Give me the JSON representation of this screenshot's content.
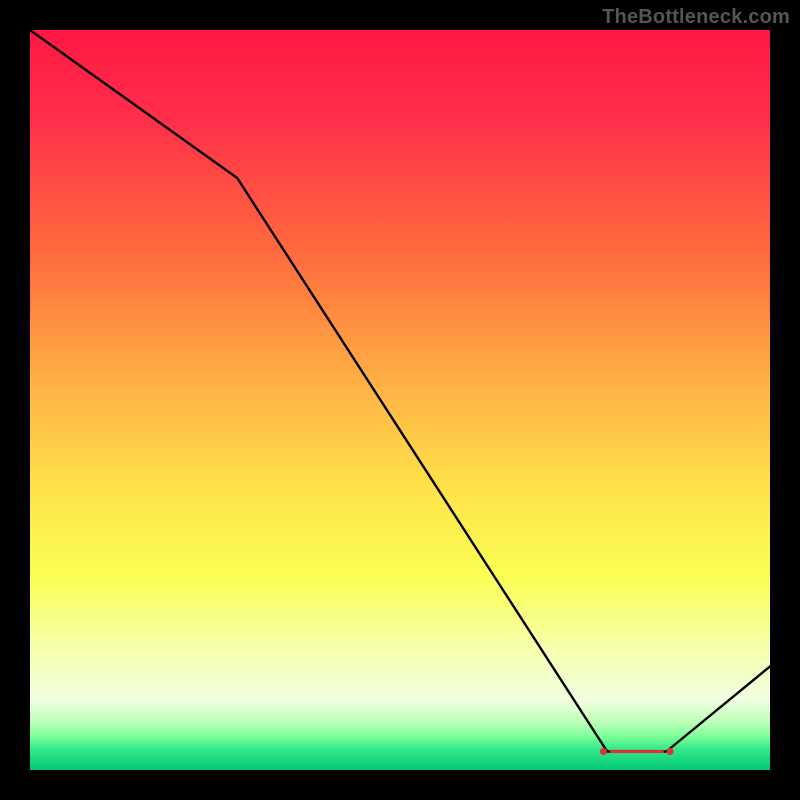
{
  "watermark": "TheBottleneck.com",
  "chart_data": {
    "type": "line",
    "title": "",
    "xlabel": "",
    "ylabel": "",
    "xlim": [
      0,
      100
    ],
    "ylim": [
      0,
      100
    ],
    "series": [
      {
        "name": "bottleneck-curve",
        "x": [
          0,
          28,
          78,
          86,
          100
        ],
        "values": [
          100,
          80,
          2.5,
          2.5,
          14
        ]
      }
    ],
    "markers": {
      "name": "optimal-range-dots",
      "color": "#d33",
      "x": [
        77.5,
        79,
        80,
        81,
        82,
        83,
        84,
        85,
        86.5
      ],
      "values": [
        2.5,
        2.5,
        2.5,
        2.5,
        2.5,
        2.5,
        2.5,
        2.5,
        2.5
      ]
    },
    "gradient_stops": [
      {
        "offset": 0.0,
        "color": "#ff1744"
      },
      {
        "offset": 0.12,
        "color": "#ff2f4a"
      },
      {
        "offset": 0.3,
        "color": "#ff6a3d"
      },
      {
        "offset": 0.48,
        "color": "#ffb244"
      },
      {
        "offset": 0.62,
        "color": "#ffe24a"
      },
      {
        "offset": 0.74,
        "color": "#fbff55"
      },
      {
        "offset": 0.84,
        "color": "#f6ffb0"
      },
      {
        "offset": 0.905,
        "color": "#f0ffe0"
      },
      {
        "offset": 0.935,
        "color": "#bfffb8"
      },
      {
        "offset": 0.955,
        "color": "#7bff99"
      },
      {
        "offset": 0.972,
        "color": "#34e889"
      },
      {
        "offset": 1.0,
        "color": "#00c874"
      }
    ],
    "legend": [],
    "grid": false
  }
}
